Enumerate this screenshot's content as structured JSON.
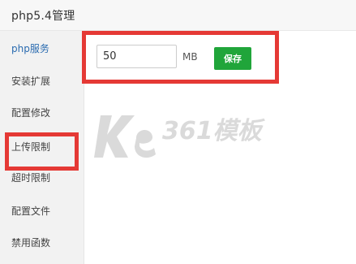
{
  "window": {
    "title": "php5.4管理"
  },
  "sidebar": {
    "items": [
      {
        "label": "php服务"
      },
      {
        "label": "安装扩展"
      },
      {
        "label": "配置修改"
      },
      {
        "label": "上传限制"
      },
      {
        "label": "超时限制"
      },
      {
        "label": "配置文件"
      },
      {
        "label": "禁用函数"
      }
    ],
    "active_item": "上传限制"
  },
  "main": {
    "upload_limit_value": "50",
    "unit": "MB",
    "save_label": "保存"
  },
  "watermark": {
    "text": "361模板",
    "logo": "Ke"
  },
  "colors": {
    "accent_green": "#20a53a",
    "highlight_red": "#e53935",
    "link_blue": "#2b6cb0"
  }
}
